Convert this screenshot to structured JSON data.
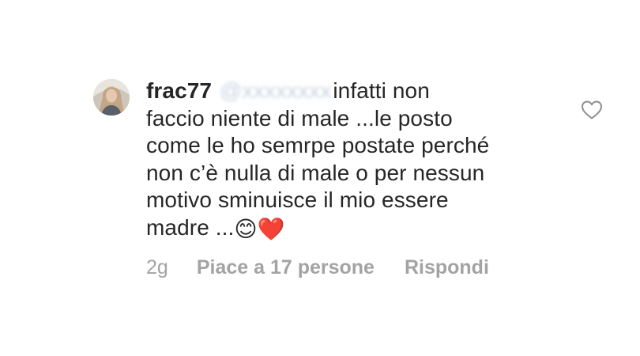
{
  "comment": {
    "username": "frac77",
    "mention": "@",
    "lines": [
      "infatti non",
      "faccio niente di male ...le posto",
      "come le ho semrpe postate perché",
      "non c’è nulla di male o per nessun",
      "motivo sminuisce il mio essere",
      "madre ..."
    ],
    "emojis": [
      "😊",
      "❤️"
    ],
    "like_icon": "heart-outline-icon",
    "meta": {
      "time": "2g",
      "likes": "Piace a 17 persone",
      "reply": "Rispondi"
    }
  },
  "colors": {
    "text": "#262626",
    "meta": "#a3a3a3",
    "mention_blurred": "#c9d2e0"
  }
}
